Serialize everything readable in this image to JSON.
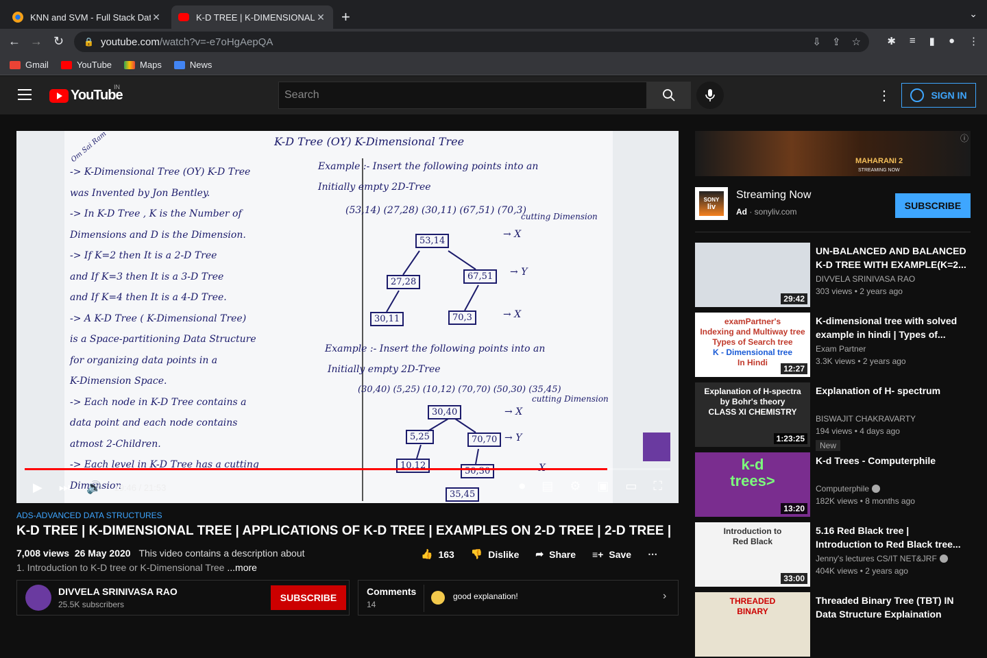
{
  "browser": {
    "tabs": [
      {
        "title": "KNN and SVM - Full Stack Data"
      },
      {
        "title": "K-D TREE | K-DIMENSIONAL TI"
      }
    ],
    "url_host": "youtube.com",
    "url_path": "/watch?v=-e7oHgAepQA",
    "bookmarks": [
      "Gmail",
      "YouTube",
      "Maps",
      "News"
    ]
  },
  "header": {
    "logo_text": "YouTube",
    "country": "IN",
    "search_placeholder": "Search",
    "signin_label": "SIGN IN"
  },
  "player": {
    "time": "19:46 / 21:53",
    "progress": 0.902,
    "board": {
      "title": "K-D Tree (OY) K-Dimensional Tree",
      "corner": "Om Sai Ram",
      "left_lines": [
        "-> K-Dimensional Tree (OY) K-D Tree",
        "was Invented by Jon Bentley.",
        "-> In K-D Tree , K is the Number of",
        "Dimensions and D is the Dimension.",
        "-> If K=2 then It is a 2-D Tree",
        "and If K=3 then It is a 3-D Tree",
        "and If K=4 then It is a 4-D Tree.",
        "-> A K-D Tree ( K-Dimensional Tree)",
        "is a Space-partitioning Data Structure",
        "for organizing data points in a",
        "K-Dimension Space.",
        "-> Each node in K-D Tree contains a",
        "data point and each node contains",
        "atmost 2-Children.",
        "-> Each level in K-D Tree has a cutting",
        "Dimension"
      ],
      "example1_lines": [
        "Example :- Insert the following points into an",
        "Initially empty 2D-Tree"
      ],
      "example1_points": "(53,14) (27,28) (30,11) (67,51) (70,3)",
      "cutting_label": "cutting Dimension",
      "tree1_nodes": [
        "53,14",
        "27,28",
        "67,51",
        "30,11",
        "70,3"
      ],
      "tree1_dims": [
        "X",
        "Y",
        "X"
      ],
      "example2_lines": [
        "Example :- Insert the following points into an",
        "Initially empty 2D-Tree"
      ],
      "example2_points": "(30,40) (5,25) (10,12) (70,70) (50,30) (35,45)",
      "tree2_nodes": [
        "30,40",
        "5,25",
        "70,70",
        "10,12",
        "50,30",
        "35,45"
      ],
      "tree2_dims": [
        "X",
        "Y",
        "X"
      ]
    }
  },
  "video": {
    "category": "ADS-ADVANCED DATA STRUCTURES",
    "title": "K-D TREE | K-DIMENSIONAL TREE | APPLICATIONS OF K-D TREE | EXAMPLES ON 2-D TREE | 2-D TREE |",
    "views": "7,008 views",
    "date": "26 May 2020",
    "desc_preview": "This video contains a description about",
    "desc_line2": "1. Introduction to K-D tree or K-Dimensional Tree",
    "more_label": "...more",
    "likes": "163",
    "dislike_label": "Dislike",
    "share_label": "Share",
    "save_label": "Save"
  },
  "channel": {
    "name": "DIVVELA SRINIVASA RAO",
    "subscribers": "25.5K subscribers",
    "subscribe_label": "SUBSCRIBE"
  },
  "comments": {
    "label": "Comments",
    "count": "14",
    "top_comment": "good explanation!"
  },
  "ad": {
    "title": "Streaming Now",
    "badge": "Ad",
    "domain": "sonyliv.com",
    "subscribe_label": "SUBSCRIBE",
    "banner_text": "MAHARANI 2",
    "banner_sub": "STREAMING NOW",
    "logo_text_top": "SONY",
    "logo_text_bottom": "liv"
  },
  "recommendations": [
    {
      "title": "UN-BALANCED AND BALANCED K-D TREE WITH EXAMPLE(K=2...",
      "channel": "DIVVELA SRINIVASA RAO",
      "meta": "303 views • 2 years ago",
      "duration": "29:42",
      "thumb_color": "#d8dde3"
    },
    {
      "title": "K-dimensional tree with solved example in hindi | Types of...",
      "channel": "Exam Partner",
      "meta": "3.3K views • 2 years ago",
      "duration": "12:27",
      "thumb_color": "#ffffff",
      "thumb_text": [
        "examPartner's",
        "Indexing and Multiway tree",
        "Types of Search tree",
        "K - Dimensional tree",
        "In Hindi"
      ]
    },
    {
      "title": "Explanation of H- spectrum",
      "channel": "BISWAJIT CHAKRAVARTY",
      "meta": "194 views • 4 days ago",
      "duration": "1:23:25",
      "badge": "New",
      "thumb_color": "#2a2a2a",
      "thumb_text": [
        "Explanation of H-spectra",
        "by Bohr's theory",
        "CLASS XI CHEMISTRY"
      ]
    },
    {
      "title": "K-d Trees - Computerphile",
      "channel": "Computerphile",
      "meta": "182K views • 8 months ago",
      "duration": "13:20",
      "verified": true,
      "thumb_color": "#7a2d8f",
      "thumb_text": [
        "k-d",
        "trees>"
      ]
    },
    {
      "title": "5.16 Red Black tree | Introduction to Red Black tree...",
      "channel": "Jenny's lectures CS/IT NET&JRF",
      "meta": "404K views • 2 years ago",
      "duration": "33:00",
      "verified": true,
      "thumb_color": "#f3f3f3",
      "thumb_text": [
        "Introduction to",
        "Red Black"
      ]
    },
    {
      "title": "Threaded Binary Tree (TBT) IN Data Structure Explaination",
      "channel": "",
      "meta": "",
      "duration": "",
      "thumb_color": "#e8e2d0",
      "thumb_text": [
        "THREADED",
        "BINARY"
      ]
    }
  ],
  "colors": {
    "yt_red": "#ff0000",
    "accent_blue": "#3ea6ff",
    "subscribe_red": "#cc0000"
  }
}
